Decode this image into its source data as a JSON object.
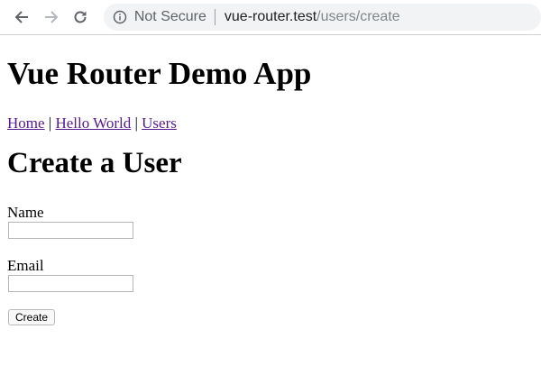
{
  "browser": {
    "security_label": "Not Secure",
    "url_host": "vue-router.test",
    "url_path": "/users/create",
    "icons": [
      "back-arrow-icon",
      "forward-arrow-icon",
      "reload-icon",
      "info-icon"
    ]
  },
  "app": {
    "title": "Vue Router Demo App",
    "nav": {
      "home": "Home",
      "hello_world": "Hello World",
      "users": "Users",
      "separator": "|"
    }
  },
  "page": {
    "heading": "Create a User",
    "form": {
      "name_label": "Name",
      "name_value": "",
      "email_label": "Email",
      "email_value": "",
      "submit_label": "Create"
    }
  },
  "colors": {
    "link": "#551a8b",
    "omnibox_bg": "#f1f3f4",
    "url_path": "#80868b"
  }
}
